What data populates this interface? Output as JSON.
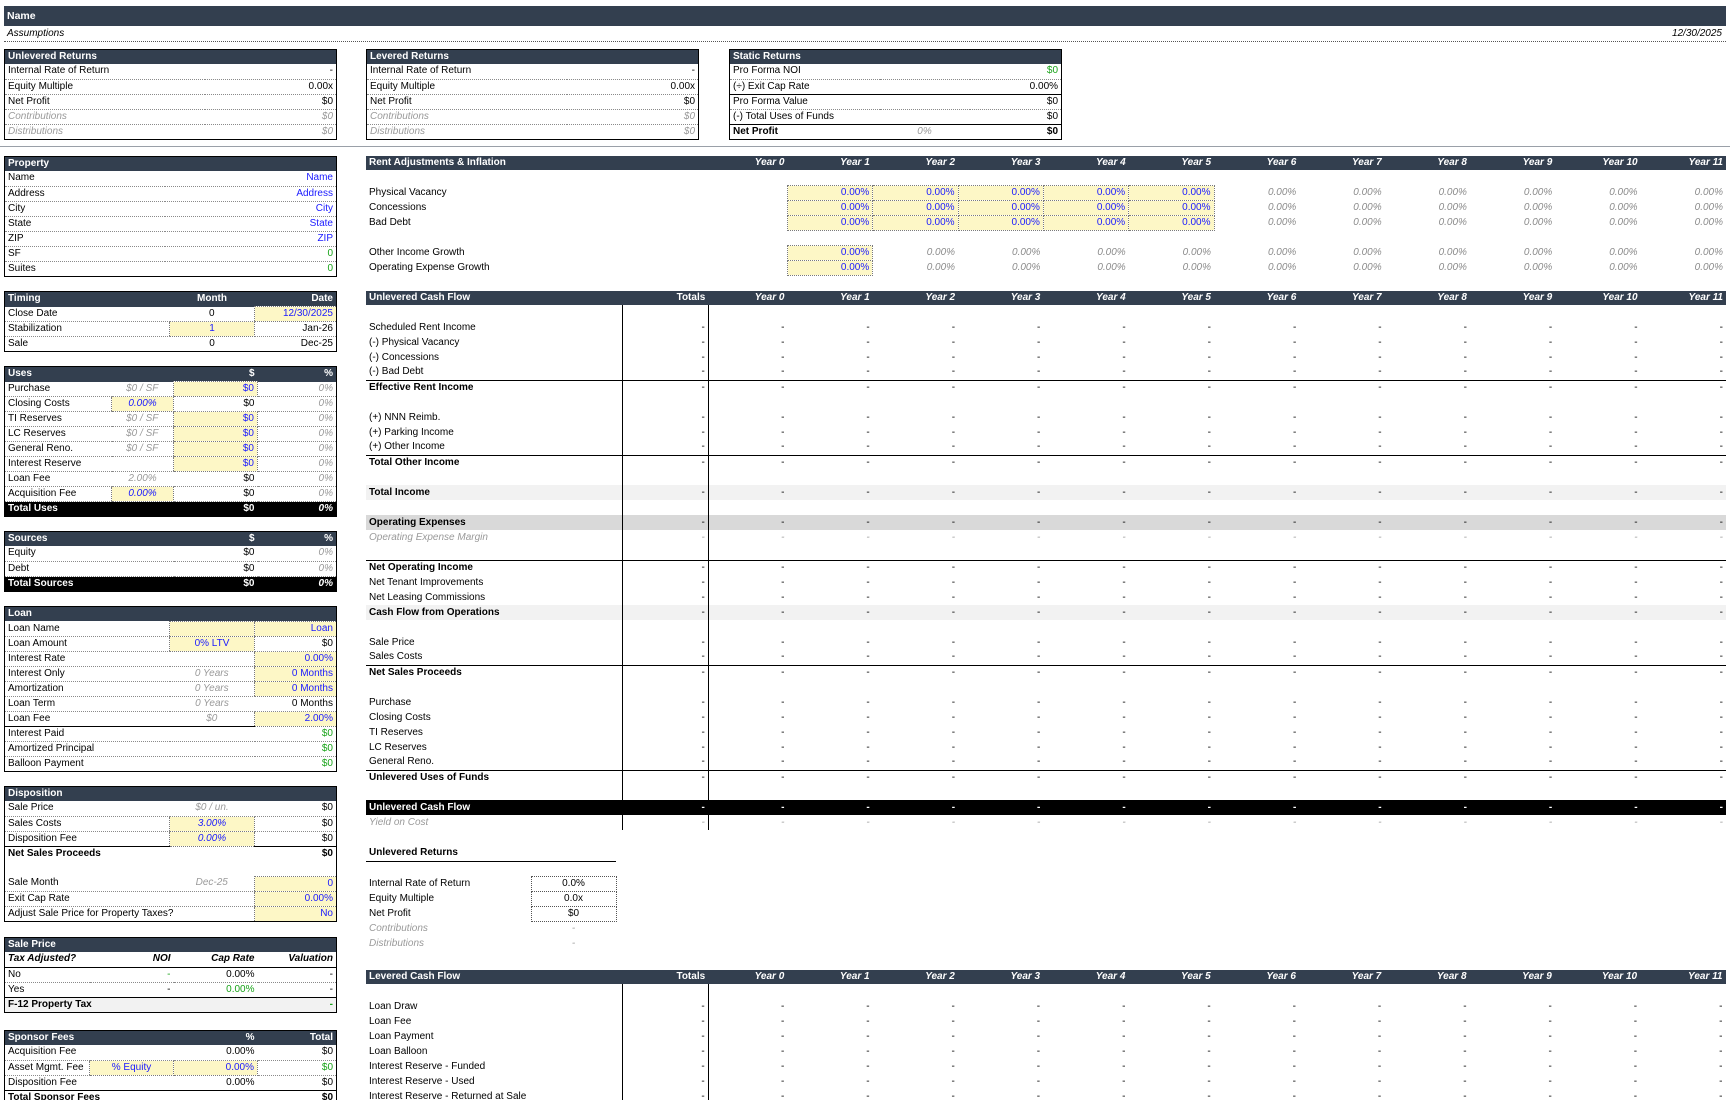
{
  "header": {
    "title": "Name",
    "assumptions": "Assumptions",
    "date": "12/30/2025"
  },
  "unlevered_returns": {
    "title": "Unlevered Returns",
    "rows": [
      {
        "label": "Internal Rate of Return",
        "value": "-"
      },
      {
        "label": "Equity Multiple",
        "value": "0.00x"
      },
      {
        "label": "Net Profit",
        "value": "$0"
      },
      {
        "label": "Contributions",
        "value": "$0"
      },
      {
        "label": "Distributions",
        "value": "$0"
      }
    ]
  },
  "levered_returns": {
    "title": "Levered Returns",
    "rows": [
      {
        "label": "Internal Rate of Return",
        "value": "-"
      },
      {
        "label": "Equity Multiple",
        "value": "0.00x"
      },
      {
        "label": "Net Profit",
        "value": "$0"
      },
      {
        "label": "Contributions",
        "value": "$0"
      },
      {
        "label": "Distributions",
        "value": "$0"
      }
    ]
  },
  "static_returns": {
    "title": "Static Returns",
    "rows": [
      {
        "label": "Pro Forma NOI",
        "mid": "",
        "value": "$0"
      },
      {
        "label": "(÷) Exit Cap Rate",
        "mid": "",
        "value": "0.00%"
      },
      {
        "label": "Pro Forma Value",
        "mid": "",
        "value": "$0"
      },
      {
        "label": "(-) Total Uses of Funds",
        "mid": "",
        "value": "$0"
      },
      {
        "label": "Net Profit",
        "mid": "0%",
        "value": "$0"
      }
    ]
  },
  "property": {
    "title": "Property",
    "rows": [
      {
        "label": "Name",
        "value": "Name"
      },
      {
        "label": "Address",
        "value": "Address"
      },
      {
        "label": "City",
        "value": "City"
      },
      {
        "label": "State",
        "value": "State"
      },
      {
        "label": "ZIP",
        "value": "ZIP"
      },
      {
        "label": "SF",
        "value": "0"
      },
      {
        "label": "Suites",
        "value": "0"
      }
    ]
  },
  "timing": {
    "title": "Timing",
    "col1": "Month",
    "col2": "Date",
    "rows": [
      {
        "label": "Close Date",
        "month": "0",
        "date": "12/30/2025"
      },
      {
        "label": "Stabilization",
        "month": "1",
        "date": "Jan-26"
      },
      {
        "label": "Sale",
        "month": "0",
        "date": "Dec-25"
      }
    ]
  },
  "uses": {
    "title": "Uses",
    "col1": "$",
    "col2": "%",
    "rows": [
      {
        "label": "Purchase",
        "a": "$0 / SF",
        "b": "$0",
        "c": "0%"
      },
      {
        "label": "Closing Costs",
        "a": "0.00%",
        "b": "$0",
        "c": "0%"
      },
      {
        "label": "TI Reserves",
        "a": "$0 / SF",
        "b": "$0",
        "c": "0%"
      },
      {
        "label": "LC Reserves",
        "a": "$0 / SF",
        "b": "$0",
        "c": "0%"
      },
      {
        "label": "General Reno.",
        "a": "$0 / SF",
        "b": "$0",
        "c": "0%"
      },
      {
        "label": "Interest Reserve",
        "a": "",
        "b": "$0",
        "c": "0%"
      },
      {
        "label": "Loan Fee",
        "a": "2.00%",
        "b": "$0",
        "c": "0%"
      },
      {
        "label": "Acquisition Fee",
        "a": "0.00%",
        "b": "$0",
        "c": "0%"
      }
    ],
    "total": {
      "label": "Total Uses",
      "b": "$0",
      "c": "0%"
    }
  },
  "sources": {
    "title": "Sources",
    "col1": "$",
    "col2": "%",
    "rows": [
      {
        "label": "Equity",
        "b": "$0",
        "c": "0%"
      },
      {
        "label": "Debt",
        "b": "$0",
        "c": "0%"
      }
    ],
    "total": {
      "label": "Total Sources",
      "b": "$0",
      "c": "0%"
    }
  },
  "loan": {
    "title": "Loan",
    "rows": [
      {
        "label": "Loan Name",
        "a": "",
        "b": "Loan"
      },
      {
        "label": "Loan Amount",
        "a": "0% LTV",
        "b": "$0"
      },
      {
        "label": "Interest Rate",
        "a": "",
        "b": "0.00%"
      },
      {
        "label": "Interest Only",
        "a": "0 Years",
        "b": "0 Months"
      },
      {
        "label": "Amortization",
        "a": "0 Years",
        "b": "0 Months"
      },
      {
        "label": "Loan Term",
        "a": "0 Years",
        "b": "0 Months"
      },
      {
        "label": "Loan Fee",
        "a": "$0",
        "b": "2.00%"
      },
      {
        "label": "Interest Paid",
        "a": "",
        "b": "$0"
      },
      {
        "label": "Amortized Principal",
        "a": "",
        "b": "$0"
      },
      {
        "label": "Balloon Payment",
        "a": "",
        "b": "$0"
      }
    ]
  },
  "disposition": {
    "title": "Disposition",
    "rows": [
      {
        "label": "Sale Price",
        "a": "$0 / un.",
        "b": "$0"
      },
      {
        "label": "Sales Costs",
        "a": "3.00%",
        "b": "$0"
      },
      {
        "label": "Disposition Fee",
        "a": "0.00%",
        "b": "$0"
      },
      {
        "label": "Net Sales Proceeds",
        "a": "",
        "b": "$0"
      },
      {
        "label": "",
        "a": "",
        "b": ""
      },
      {
        "label": "Sale Month",
        "a": "Dec-25",
        "b": "0"
      },
      {
        "label": "Exit Cap Rate",
        "a": "",
        "b": "0.00%"
      },
      {
        "label": "Adjust Sale Price for Property Taxes?",
        "a": "",
        "b": "No"
      }
    ]
  },
  "sale_price": {
    "title": "Sale Price",
    "head": [
      "Tax Adjusted?",
      "NOI",
      "Cap Rate",
      "Valuation"
    ],
    "rows": [
      [
        "No",
        "-",
        "0.00%",
        "-"
      ],
      [
        "Yes",
        "-",
        "0.00%",
        "-"
      ]
    ],
    "footer": "F-12 Property Tax",
    "footer_val": "-"
  },
  "sponsor_fees": {
    "title": "Sponsor Fees",
    "col1": "%",
    "col2": "Total",
    "rows": [
      {
        "label": "Acquisition Fee",
        "a": "",
        "b": "0.00%",
        "c": "$0"
      },
      {
        "label": "Asset Mgmt. Fee",
        "a": "% Equity",
        "b": "0.00%",
        "c": "$0"
      },
      {
        "label": "Disposition Fee",
        "a": "",
        "b": "0.00%",
        "c": "$0"
      }
    ],
    "total": {
      "label": "Total Sponsor Fees",
      "c": "$0"
    }
  },
  "years": [
    "Year 0",
    "Year 1",
    "Year 2",
    "Year 3",
    "Year 4",
    "Year 5",
    "Year 6",
    "Year 7",
    "Year 8",
    "Year 9",
    "Year 10",
    "Year 11"
  ],
  "rent_adj": {
    "title": "Rent Adjustments & Inflation",
    "rows": [
      {
        "label": "Physical Vacancy",
        "input": [
          "0.00%",
          "0.00%",
          "0.00%",
          "0.00%",
          "0.00%"
        ],
        "rest": [
          "0.00%",
          "0.00%",
          "0.00%",
          "0.00%",
          "0.00%",
          "0.00%"
        ]
      },
      {
        "label": "Concessions",
        "input": [
          "0.00%",
          "0.00%",
          "0.00%",
          "0.00%",
          "0.00%"
        ],
        "rest": [
          "0.00%",
          "0.00%",
          "0.00%",
          "0.00%",
          "0.00%",
          "0.00%"
        ]
      },
      {
        "label": "Bad Debt",
        "input": [
          "0.00%",
          "0.00%",
          "0.00%",
          "0.00%",
          "0.00%"
        ],
        "rest": [
          "0.00%",
          "0.00%",
          "0.00%",
          "0.00%",
          "0.00%",
          "0.00%"
        ]
      },
      {
        "label": "Other Income Growth",
        "input": [
          "0.00%"
        ],
        "rest": [
          "0.00%",
          "0.00%",
          "0.00%",
          "0.00%",
          "0.00%",
          "0.00%",
          "0.00%",
          "0.00%",
          "0.00%",
          "0.00%"
        ]
      },
      {
        "label": "Operating Expense Growth",
        "input": [
          "0.00%"
        ],
        "rest": [
          "0.00%",
          "0.00%",
          "0.00%",
          "0.00%",
          "0.00%",
          "0.00%",
          "0.00%",
          "0.00%",
          "0.00%",
          "0.00%"
        ]
      }
    ]
  },
  "ucf": {
    "title": "Unlevered Cash Flow",
    "totals": "Totals",
    "dash": "-",
    "rows": [
      {
        "label": "",
        "type": "blank"
      },
      {
        "label": "Scheduled Rent Income",
        "type": "row"
      },
      {
        "label": "(-) Physical Vacancy",
        "type": "row"
      },
      {
        "label": "(-) Concessions",
        "type": "row"
      },
      {
        "label": "(-) Bad Debt",
        "type": "row"
      },
      {
        "label": "Effective Rent Income",
        "type": "bold"
      },
      {
        "label": "",
        "type": "blank"
      },
      {
        "label": "(+) NNN Reimb.",
        "type": "row"
      },
      {
        "label": "(+) Parking Income",
        "type": "row"
      },
      {
        "label": "(+) Other Income",
        "type": "row"
      },
      {
        "label": "Total Other Income",
        "type": "bold"
      },
      {
        "label": "",
        "type": "blank"
      },
      {
        "label": "Total Income",
        "type": "shaded"
      },
      {
        "label": "",
        "type": "blank"
      },
      {
        "label": "Operating Expenses",
        "type": "shaded2"
      },
      {
        "label": "Operating Expense Margin",
        "type": "gi"
      },
      {
        "label": "",
        "type": "blank"
      },
      {
        "label": "Net Operating Income",
        "type": "bold"
      },
      {
        "label": "Net Tenant Improvements",
        "type": "row"
      },
      {
        "label": "Net Leasing Commissions",
        "type": "row"
      },
      {
        "label": "Cash Flow from Operations",
        "type": "shaded"
      },
      {
        "label": "",
        "type": "blank"
      },
      {
        "label": "Sale Price",
        "type": "row"
      },
      {
        "label": "Sales Costs",
        "type": "row"
      },
      {
        "label": "Net Sales Proceeds",
        "type": "bold"
      },
      {
        "label": "",
        "type": "blank"
      },
      {
        "label": "Purchase",
        "type": "row"
      },
      {
        "label": "Closing Costs",
        "type": "row"
      },
      {
        "label": "TI Reserves",
        "type": "row"
      },
      {
        "label": "LC Reserves",
        "type": "row"
      },
      {
        "label": "General Reno.",
        "type": "row"
      },
      {
        "label": "Unlevered Uses of Funds",
        "type": "bold"
      },
      {
        "label": "",
        "type": "blank"
      },
      {
        "label": "Unlevered Cash Flow",
        "type": "black"
      },
      {
        "label": "Yield on Cost",
        "type": "gi"
      }
    ]
  },
  "ur_small": {
    "title": "Unlevered Returns",
    "rows": [
      {
        "label": "Internal Rate of Return",
        "value": "0.0%"
      },
      {
        "label": "Equity Multiple",
        "value": "0.0x"
      },
      {
        "label": "Net Profit",
        "value": "$0"
      },
      {
        "label": "Contributions",
        "value": "-"
      },
      {
        "label": "Distributions",
        "value": "-"
      }
    ]
  },
  "lcf": {
    "title": "Levered Cash Flow",
    "totals": "Totals",
    "rows": [
      {
        "label": ""
      },
      {
        "label": "Loan Draw"
      },
      {
        "label": "Loan Fee"
      },
      {
        "label": "Loan Payment"
      },
      {
        "label": "Loan Balloon"
      },
      {
        "label": "Interest Reserve - Funded"
      },
      {
        "label": "Interest Reserve - Used"
      },
      {
        "label": "Interest Reserve - Returned at Sale"
      }
    ]
  }
}
